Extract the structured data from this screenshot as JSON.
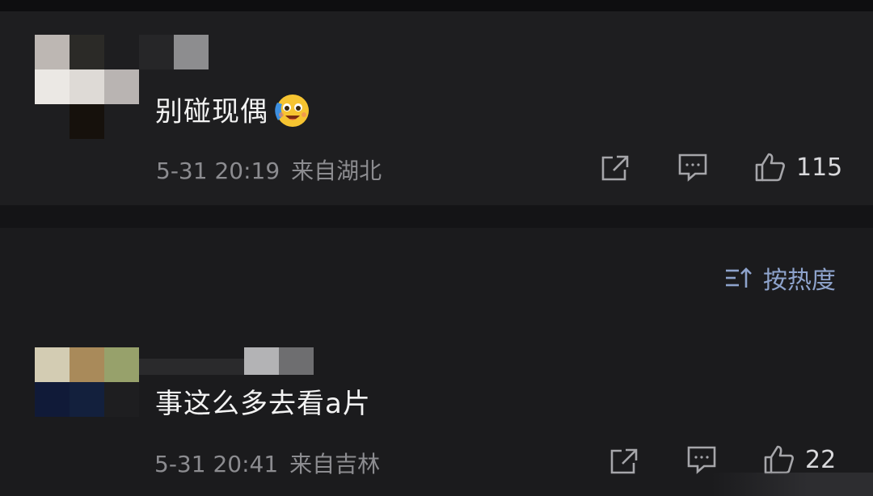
{
  "comments": [
    {
      "text": "别碰现偶",
      "emoji_icon": "crying-laughing-emoji-icon",
      "date": "5-31 20:19",
      "location": "来自湖北",
      "likes": "115"
    },
    {
      "text": "事这么多去看a片",
      "date": "5-31 20:41",
      "location": "来自吉林",
      "likes": "22"
    }
  ],
  "sort": {
    "label": "按热度",
    "icon": "sort-lines-icon"
  },
  "icons": {
    "share": "share-icon",
    "reply": "comment-icon",
    "like": "thumbs-up-icon"
  },
  "colors": {
    "background": "#1e1e20",
    "accent": "#8ea3cc",
    "meta": "#8c8c90"
  }
}
